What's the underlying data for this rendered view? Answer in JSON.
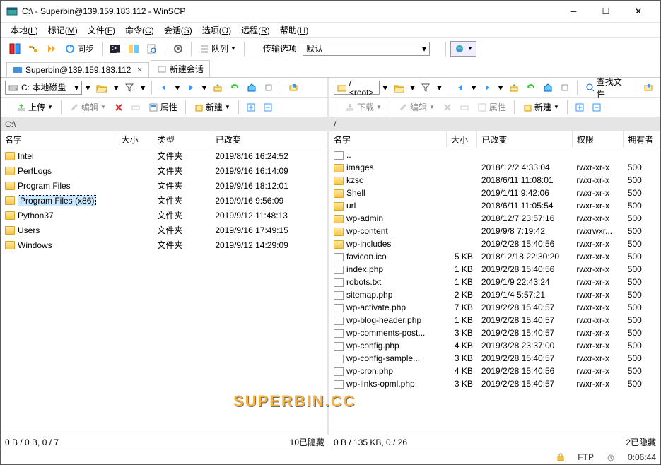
{
  "title": "C:\\ - Superbin@139.159.183.112 - WinSCP",
  "menu": [
    "本地(L)",
    "标记(M)",
    "文件(F)",
    "命令(C)",
    "会话(S)",
    "选项(O)",
    "远程(R)",
    "帮助(H)"
  ],
  "toolbar1": {
    "sync": "同步",
    "queue": "队列",
    "transfer_label": "传输选项",
    "transfer_value": "默认"
  },
  "tabs": {
    "session": "Superbin@139.159.183.112",
    "new": "新建会话"
  },
  "left": {
    "drive": "C: 本地磁盘",
    "ops": {
      "upload": "上传",
      "edit": "编辑",
      "props": "属性",
      "new": "新建"
    },
    "path": "C:\\",
    "cols": [
      "名字",
      "大小",
      "类型",
      "已改变"
    ],
    "rows": [
      {
        "n": "Intel",
        "t": "文件夹",
        "d": "2019/8/16  16:24:52",
        "k": "folder"
      },
      {
        "n": "PerfLogs",
        "t": "文件夹",
        "d": "2019/9/16  16:14:09",
        "k": "folder"
      },
      {
        "n": "Program Files",
        "t": "文件夹",
        "d": "2019/9/16  18:12:01",
        "k": "folder"
      },
      {
        "n": "Program Files (x86)",
        "t": "文件夹",
        "d": "2019/9/16  9:56:09",
        "k": "folder",
        "sel": true
      },
      {
        "n": "Python37",
        "t": "文件夹",
        "d": "2019/9/12  11:48:13",
        "k": "folder"
      },
      {
        "n": "Users",
        "t": "文件夹",
        "d": "2019/9/16  17:49:15",
        "k": "folder"
      },
      {
        "n": "Windows",
        "t": "文件夹",
        "d": "2019/9/12  14:29:09",
        "k": "folder"
      }
    ],
    "status_l": "0 B / 0 B,   0 / 7",
    "status_r": "10已隐藏"
  },
  "right": {
    "root": "/ <root>",
    "find": "查找文件",
    "ops": {
      "download": "下载",
      "edit": "编辑",
      "props": "属性",
      "new": "新建"
    },
    "path": "/",
    "cols": [
      "名字",
      "大小",
      "已改变",
      "权限",
      "拥有者"
    ],
    "rows": [
      {
        "n": "..",
        "k": "up"
      },
      {
        "n": "images",
        "d": "2018/12/2 4:33:04",
        "p": "rwxr-xr-x",
        "o": "500",
        "k": "folder"
      },
      {
        "n": "kzsc",
        "d": "2018/6/11 11:08:01",
        "p": "rwxr-xr-x",
        "o": "500",
        "k": "folder"
      },
      {
        "n": "Shell",
        "d": "2019/1/11 9:42:06",
        "p": "rwxr-xr-x",
        "o": "500",
        "k": "folder"
      },
      {
        "n": "url",
        "d": "2018/6/11 11:05:54",
        "p": "rwxr-xr-x",
        "o": "500",
        "k": "folder"
      },
      {
        "n": "wp-admin",
        "d": "2018/12/7 23:57:16",
        "p": "rwxr-xr-x",
        "o": "500",
        "k": "folder"
      },
      {
        "n": "wp-content",
        "d": "2019/9/8 7:19:42",
        "p": "rwxrwxr...",
        "o": "500",
        "k": "folder"
      },
      {
        "n": "wp-includes",
        "d": "2019/2/28 15:40:56",
        "p": "rwxr-xr-x",
        "o": "500",
        "k": "folder"
      },
      {
        "n": "favicon.ico",
        "s": "5 KB",
        "d": "2018/12/18 22:30:20",
        "p": "rwxr-xr-x",
        "o": "500",
        "k": "file"
      },
      {
        "n": "index.php",
        "s": "1 KB",
        "d": "2019/2/28 15:40:56",
        "p": "rwxr-xr-x",
        "o": "500",
        "k": "file"
      },
      {
        "n": "robots.txt",
        "s": "1 KB",
        "d": "2019/1/9 22:43:24",
        "p": "rwxr-xr-x",
        "o": "500",
        "k": "file"
      },
      {
        "n": "sitemap.php",
        "s": "2 KB",
        "d": "2019/1/4 5:57:21",
        "p": "rwxr-xr-x",
        "o": "500",
        "k": "file"
      },
      {
        "n": "wp-activate.php",
        "s": "7 KB",
        "d": "2019/2/28 15:40:57",
        "p": "rwxr-xr-x",
        "o": "500",
        "k": "file"
      },
      {
        "n": "wp-blog-header.php",
        "s": "1 KB",
        "d": "2019/2/28 15:40:57",
        "p": "rwxr-xr-x",
        "o": "500",
        "k": "file"
      },
      {
        "n": "wp-comments-post...",
        "s": "3 KB",
        "d": "2019/2/28 15:40:57",
        "p": "rwxr-xr-x",
        "o": "500",
        "k": "file"
      },
      {
        "n": "wp-config.php",
        "s": "4 KB",
        "d": "2019/3/28 23:37:00",
        "p": "rwxr-xr-x",
        "o": "500",
        "k": "file"
      },
      {
        "n": "wp-config-sample...",
        "s": "3 KB",
        "d": "2019/2/28 15:40:57",
        "p": "rwxr-xr-x",
        "o": "500",
        "k": "file"
      },
      {
        "n": "wp-cron.php",
        "s": "4 KB",
        "d": "2019/2/28 15:40:56",
        "p": "rwxr-xr-x",
        "o": "500",
        "k": "file"
      },
      {
        "n": "wp-links-opml.php",
        "s": "3 KB",
        "d": "2019/2/28 15:40:57",
        "p": "rwxr-xr-x",
        "o": "500",
        "k": "file"
      }
    ],
    "status_l": "0 B / 135 KB,   0 / 26",
    "status_r": "2已隐藏"
  },
  "statusbar": {
    "proto": "FTP",
    "time": "0:06:44"
  },
  "watermark": "SUPERBIN.CC"
}
